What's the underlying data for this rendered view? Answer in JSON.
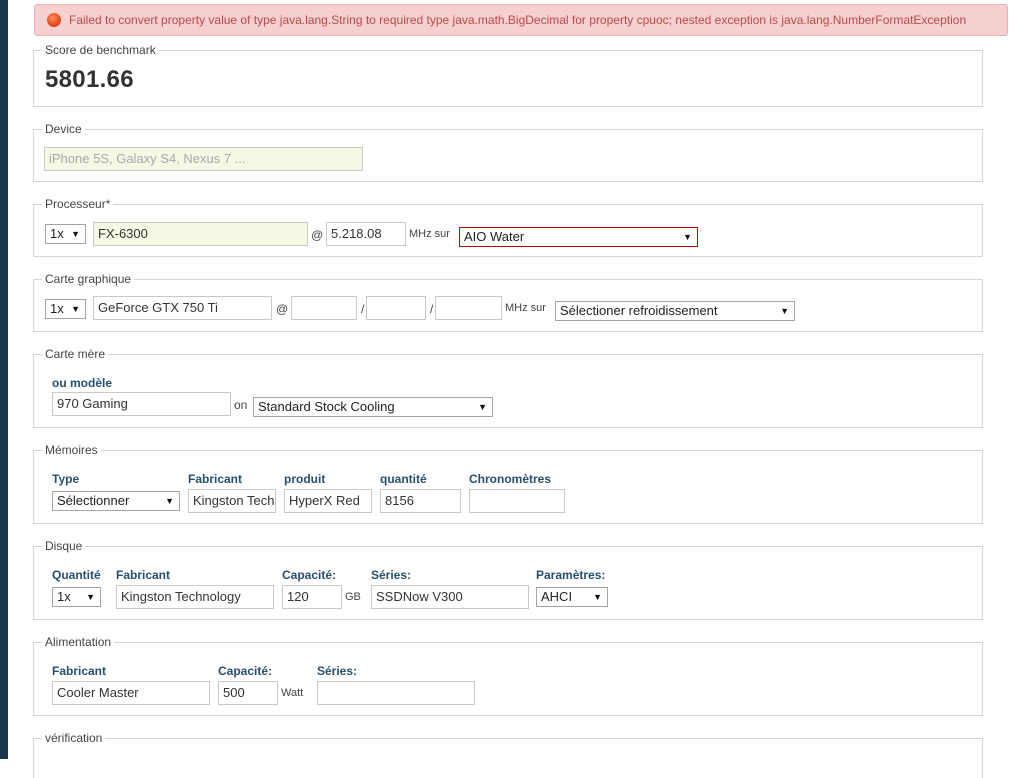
{
  "alert": {
    "message": "Failed to convert property value of type java.lang.String to required type java.math.BigDecimal for property cpuoc; nested exception is java.lang.NumberFormatException"
  },
  "score": {
    "legend": "Score de benchmark",
    "value": "5801.66"
  },
  "device": {
    "legend": "Device",
    "placeholder": "iPhone 5S, Galaxy S4, Nexus 7 ..."
  },
  "cpu": {
    "legend": "Processeur*",
    "count": "1x",
    "model": "FX-6300",
    "at": "@",
    "freq": "5.218.08",
    "unit": "MHz sur",
    "cooling": "AIO Water"
  },
  "gpu": {
    "legend": "Carte graphique",
    "count": "1x",
    "model": "GeForce GTX 750 Ti",
    "at": "@",
    "slash": "/",
    "unit": "MHz sur",
    "cooling": "Sélectioner refroidissement"
  },
  "motherboard": {
    "legend": "Carte mère",
    "model_label": "ou modèle",
    "model": "970 Gaming",
    "on": "on",
    "cooling": "Standard Stock Cooling"
  },
  "memory": {
    "legend": "Mémoires",
    "headers": {
      "type": "Type",
      "manufacturer": "Fabricant",
      "product": "produit",
      "quantity": "quantité",
      "timings": "Chronomètres"
    },
    "type": "Sélectionner",
    "manufacturer": "Kingston Tech",
    "product": "HyperX Red",
    "quantity": "8156",
    "timings": ""
  },
  "disk": {
    "legend": "Disque",
    "headers": {
      "quantity": "Quantité",
      "manufacturer": "Fabricant",
      "capacity": "Capacité:",
      "series": "Séries:",
      "params": "Paramètres:"
    },
    "quantity": "1x",
    "manufacturer": "Kingston Technology",
    "capacity": "120",
    "capacity_unit": "GB",
    "series": "SSDNow V300",
    "params": "AHCI"
  },
  "psu": {
    "legend": "Alimentation",
    "headers": {
      "manufacturer": "Fabricant",
      "capacity": "Capacité:",
      "series": "Séries:"
    },
    "manufacturer": "Cooler Master",
    "capacity": "500",
    "capacity_unit": "Watt",
    "series": ""
  },
  "verification": {
    "legend": "vérification"
  },
  "icons": {
    "alert": "alert-icon",
    "dropdown": "chevron-down-icon"
  },
  "colors": {
    "alert_bg": "#f6d0d0",
    "alert_text": "#b94a48",
    "label_blue": "#26506e",
    "left_bar": "#17394e",
    "invalid_border": "#c00000"
  }
}
